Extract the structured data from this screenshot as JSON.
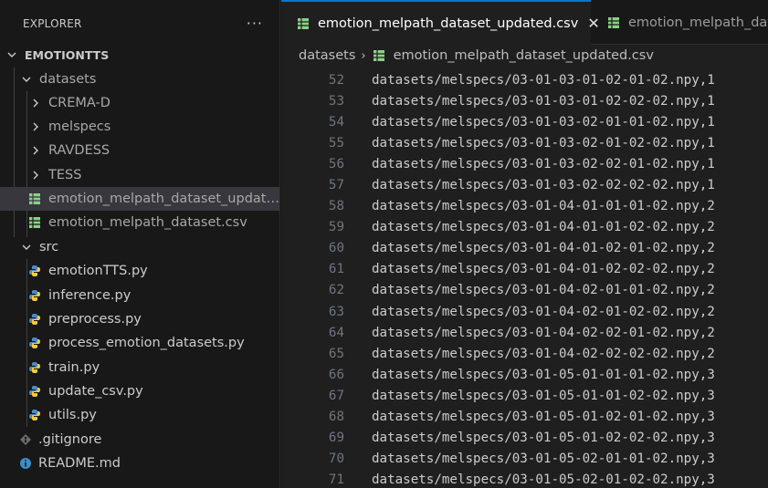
{
  "explorer": {
    "title": "EXPLORER",
    "more_actions": "···"
  },
  "tree": {
    "root": "EMOTIONTTS",
    "datasets": "datasets",
    "crema": "CREMA-D",
    "melspecs": "melspecs",
    "ravdess": "RAVDESS",
    "tess": "TESS",
    "csv_updated": "emotion_melpath_dataset_updated...",
    "csv_original": "emotion_melpath_dataset.csv",
    "src": "src",
    "py_files": [
      "emotionTTS.py",
      "inference.py",
      "preprocess.py",
      "process_emotion_datasets.py",
      "train.py",
      "update_csv.py",
      "utils.py"
    ],
    "gitignore": ".gitignore",
    "readme": "README.md"
  },
  "tabs": {
    "active_label": "emotion_melpath_dataset_updated.csv",
    "close_glyph": "✕",
    "inactive_label": "emotion_melpath_dataset.csv"
  },
  "breadcrumbs": {
    "folder": "datasets",
    "separator": "›",
    "file": "emotion_melpath_dataset_updated.csv"
  },
  "code_lines": [
    {
      "n": "52",
      "t": "datasets/melspecs/03-01-03-01-02-01-02.npy,1"
    },
    {
      "n": "53",
      "t": "datasets/melspecs/03-01-03-01-02-02-02.npy,1"
    },
    {
      "n": "54",
      "t": "datasets/melspecs/03-01-03-02-01-01-02.npy,1"
    },
    {
      "n": "55",
      "t": "datasets/melspecs/03-01-03-02-01-02-02.npy,1"
    },
    {
      "n": "56",
      "t": "datasets/melspecs/03-01-03-02-02-01-02.npy,1"
    },
    {
      "n": "57",
      "t": "datasets/melspecs/03-01-03-02-02-02-02.npy,1"
    },
    {
      "n": "58",
      "t": "datasets/melspecs/03-01-04-01-01-01-02.npy,2"
    },
    {
      "n": "59",
      "t": "datasets/melspecs/03-01-04-01-01-02-02.npy,2"
    },
    {
      "n": "60",
      "t": "datasets/melspecs/03-01-04-01-02-01-02.npy,2"
    },
    {
      "n": "61",
      "t": "datasets/melspecs/03-01-04-01-02-02-02.npy,2"
    },
    {
      "n": "62",
      "t": "datasets/melspecs/03-01-04-02-01-01-02.npy,2"
    },
    {
      "n": "63",
      "t": "datasets/melspecs/03-01-04-02-01-02-02.npy,2"
    },
    {
      "n": "64",
      "t": "datasets/melspecs/03-01-04-02-02-01-02.npy,2"
    },
    {
      "n": "65",
      "t": "datasets/melspecs/03-01-04-02-02-02-02.npy,2"
    },
    {
      "n": "66",
      "t": "datasets/melspecs/03-01-05-01-01-01-02.npy,3"
    },
    {
      "n": "67",
      "t": "datasets/melspecs/03-01-05-01-01-02-02.npy,3"
    },
    {
      "n": "68",
      "t": "datasets/melspecs/03-01-05-01-02-01-02.npy,3"
    },
    {
      "n": "69",
      "t": "datasets/melspecs/03-01-05-01-02-02-02.npy,3"
    },
    {
      "n": "70",
      "t": "datasets/melspecs/03-01-05-02-01-01-02.npy,3"
    },
    {
      "n": "71",
      "t": "datasets/melspecs/03-01-05-02-01-02-02.npy,3"
    }
  ],
  "colors": {
    "csv_icon": "#89d185",
    "python_icon_blue": "#4b8bbe",
    "python_icon_yellow": "#ffd43b",
    "accent": "#0078d4",
    "selected_row": "#37373d"
  }
}
